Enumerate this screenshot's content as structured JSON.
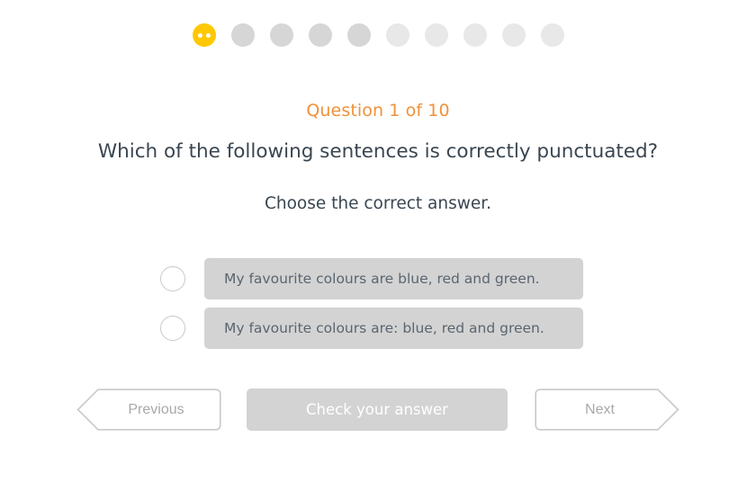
{
  "colors": {
    "background": "#ffffff",
    "accent_active_dot": "#ffc800",
    "counter_orange": "#f0913a",
    "text_dark": "#3a4651",
    "option_bg": "#d3d3d3",
    "option_text": "#5a6570",
    "button_disabled_bg": "#d3d3d3",
    "nav_outline": "#c9c9c9",
    "nav_text": "#a9a9a9",
    "dot_seen": "#d6d6d6",
    "dot_unseen": "#e8e8e8"
  },
  "progress": {
    "total": 10,
    "current": 1,
    "dots": [
      {
        "state": "active",
        "icon": "smiley-face-icon"
      },
      {
        "state": "seen",
        "icon": "dot-icon"
      },
      {
        "state": "seen",
        "icon": "dot-icon"
      },
      {
        "state": "seen",
        "icon": "dot-icon"
      },
      {
        "state": "seen",
        "icon": "dot-icon"
      },
      {
        "state": "unseen",
        "icon": "dot-icon"
      },
      {
        "state": "unseen",
        "icon": "dot-icon"
      },
      {
        "state": "unseen",
        "icon": "dot-icon"
      },
      {
        "state": "unseen",
        "icon": "dot-icon"
      },
      {
        "state": "unseen",
        "icon": "dot-icon"
      }
    ]
  },
  "question": {
    "counter": "Question 1 of 10",
    "title": "Which of the following sentences is correctly punctuated?",
    "instruction": "Choose the correct answer."
  },
  "options": [
    {
      "id": "option-a",
      "label": "My favourite colours are blue, red and green.",
      "selected": false
    },
    {
      "id": "option-b",
      "label": "My favourite colours are: blue, red and green.",
      "selected": false
    }
  ],
  "nav": {
    "previous_label": "Previous",
    "check_label": "Check your answer",
    "next_label": "Next"
  }
}
